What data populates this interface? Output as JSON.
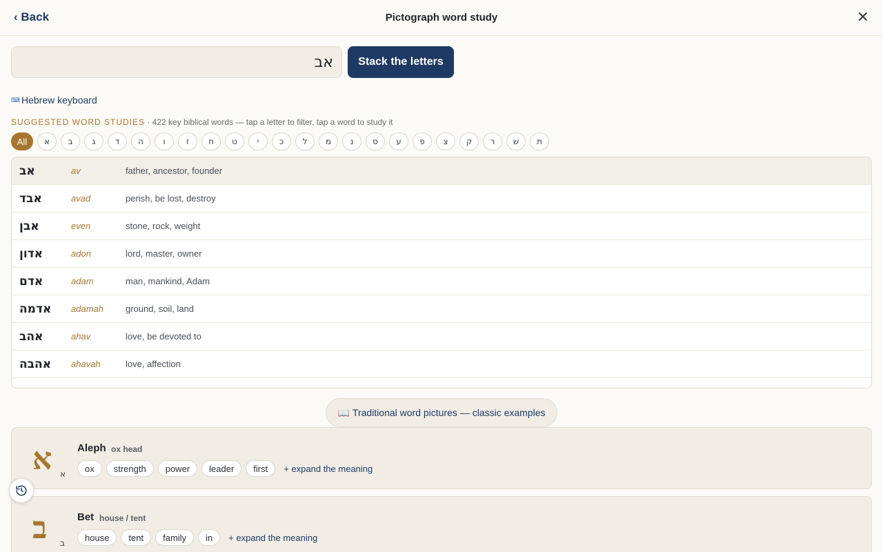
{
  "header": {
    "back_label": "‹ Back",
    "title": "Pictograph word study",
    "close_glyph": "✕"
  },
  "search": {
    "value": "אב",
    "button_label": "Stack the letters"
  },
  "keyboard_link": {
    "icon": "⌨",
    "label": "Hebrew keyboard"
  },
  "suggestions": {
    "heading": "SUGGESTED WORD STUDIES",
    "subtext": " · 422 key biblical words — tap a letter to filter, tap a word to study it",
    "filters": [
      "All",
      "א",
      "ב",
      "ג",
      "ד",
      "ה",
      "ו",
      "ז",
      "ח",
      "ט",
      "י",
      "כ",
      "ל",
      "מ",
      "נ",
      "ס",
      "ע",
      "פ",
      "צ",
      "ק",
      "ר",
      "ש",
      "ת"
    ],
    "words": [
      {
        "hebrew": "אב",
        "translit": "av",
        "gloss": "father, ancestor, founder"
      },
      {
        "hebrew": "אבד",
        "translit": "avad",
        "gloss": "perish, be lost, destroy"
      },
      {
        "hebrew": "אבן",
        "translit": "even",
        "gloss": "stone, rock, weight"
      },
      {
        "hebrew": "אדון",
        "translit": "adon",
        "gloss": "lord, master, owner"
      },
      {
        "hebrew": "אדם",
        "translit": "adam",
        "gloss": "man, mankind, Adam"
      },
      {
        "hebrew": "אדמה",
        "translit": "adamah",
        "gloss": "ground, soil, land"
      },
      {
        "hebrew": "אהב",
        "translit": "ahav",
        "gloss": "love, be devoted to"
      },
      {
        "hebrew": "אהבה",
        "translit": "ahavah",
        "gloss": "love, affection"
      }
    ]
  },
  "pictures_button": {
    "icon": "📖",
    "label": "Traditional word pictures — classic examples"
  },
  "letters": [
    {
      "glyph": "א",
      "name": "Aleph",
      "meaning": "ox head",
      "tags": [
        "ox",
        "strength",
        "power",
        "leader",
        "first"
      ],
      "expand_label": "+ expand the meaning"
    },
    {
      "glyph": "ב",
      "name": "Bet",
      "meaning": "house / tent",
      "tags": [
        "house",
        "tent",
        "family",
        "in"
      ],
      "expand_label": "+ expand the meaning"
    }
  ],
  "colors": {
    "accent_navy": "#1e3a64",
    "accent_gold": "#a7762e"
  }
}
